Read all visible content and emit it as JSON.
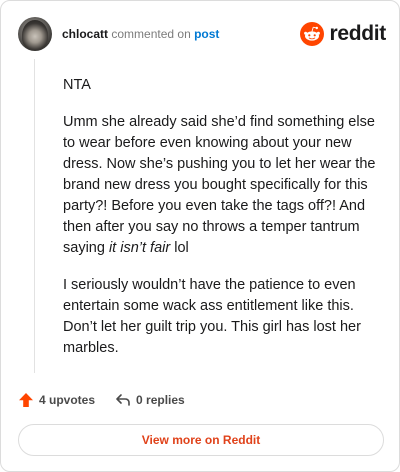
{
  "header": {
    "username": "chlocatt",
    "action_text": "commented on",
    "post_link": "post",
    "logo_text": "reddit"
  },
  "comment": {
    "line1": "NTA",
    "para1_start": "Umm she already said she’d find something else to wear before even knowing about your new dress. Now she’s pushing you to let her wear the brand new dress you bought specifically for this party?! Before you even take the tags off?! And then after you say no throws a temper tantrum saying ",
    "para1_italic": "it isn’t fair",
    "para1_end": " lol",
    "para2": "I seriously wouldn’t have the patience to even entertain some wack ass entitlement like this. Don’t let her guilt trip you. This girl has lost her marbles."
  },
  "actions": {
    "upvotes": "4 upvotes",
    "replies": "0 replies"
  },
  "footer": {
    "view_more": "View more on Reddit"
  },
  "colors": {
    "brand_orange": "#ff4500",
    "upvote_orange": "#ff4500",
    "link_blue": "#0079d3",
    "view_more_red": "#e0421a"
  },
  "icons": [
    "user-avatar",
    "reddit-snoo-icon",
    "upvote-arrow-icon",
    "reply-arrow-icon"
  ]
}
